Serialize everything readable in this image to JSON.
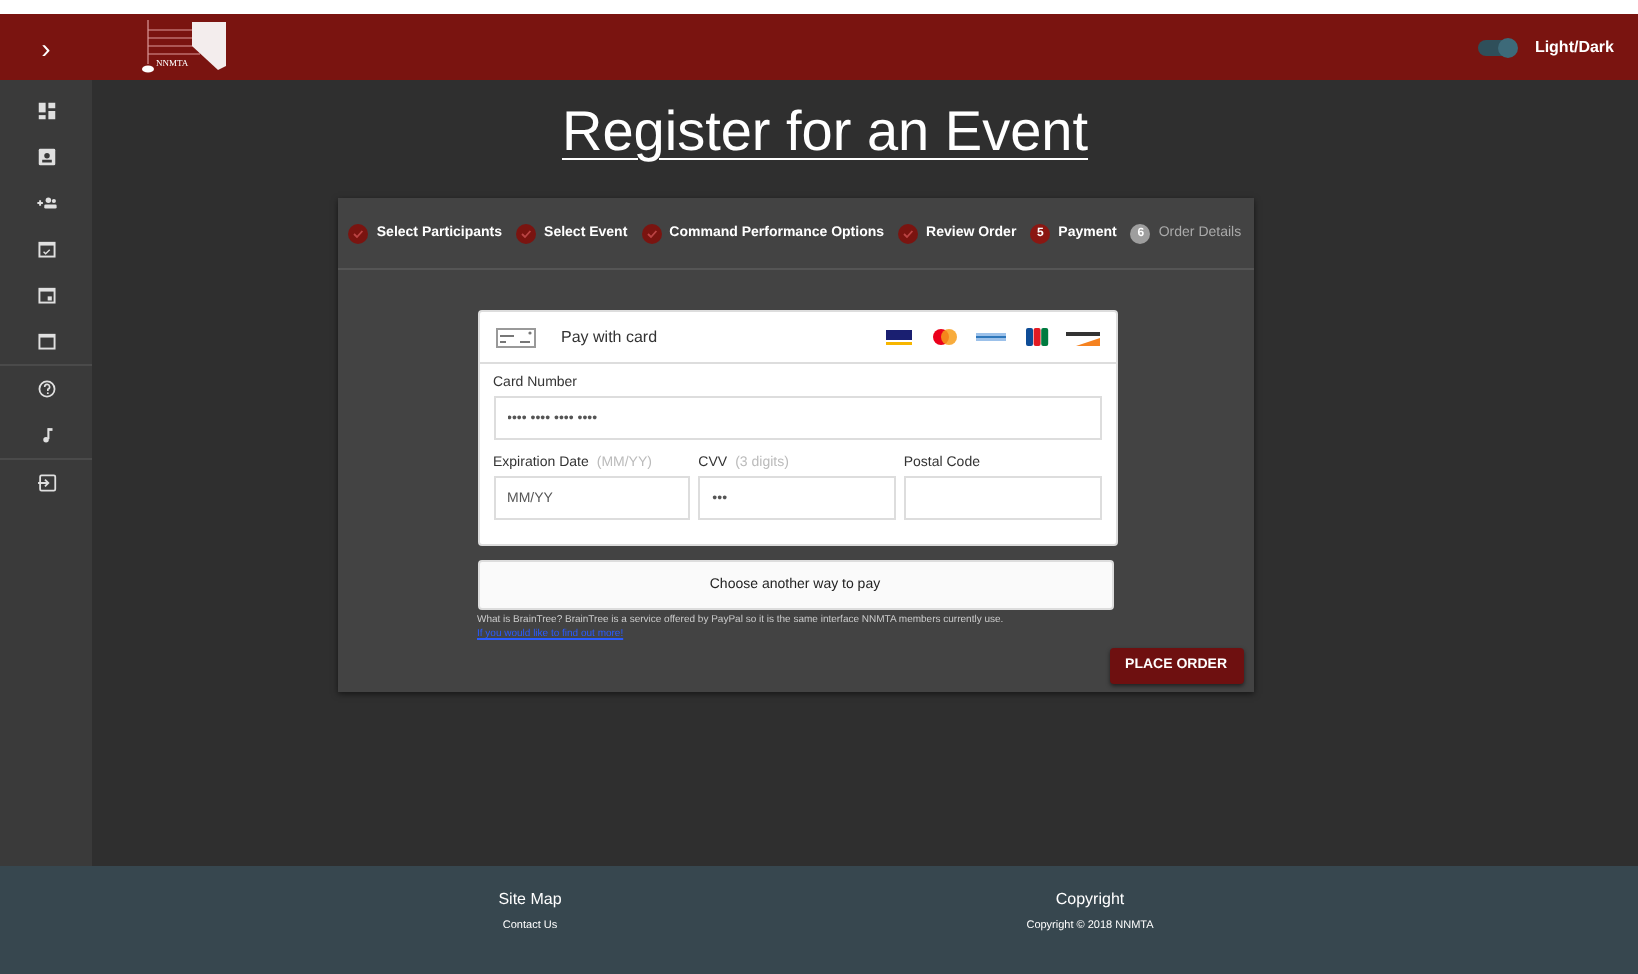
{
  "header": {
    "menu_toggle": "›",
    "logo_text": "NNMTA",
    "theme_toggle": {
      "label": "Light/Dark",
      "on": true
    }
  },
  "title": "Register for an Event",
  "steps": [
    {
      "kind": "done",
      "label": "Select Participants"
    },
    {
      "kind": "done",
      "label": "Select Event"
    },
    {
      "kind": "done",
      "label": "Command Performance Options"
    },
    {
      "kind": "done",
      "label": "Review Order"
    },
    {
      "kind": "current",
      "number": "5",
      "label": "Payment"
    },
    {
      "kind": "pending",
      "number": "6",
      "label": "Order Details"
    }
  ],
  "payment": {
    "heading": "Pay with card",
    "card_number": {
      "label": "Card Number",
      "placeholder": "•••• •••• •••• ••••"
    },
    "expiration": {
      "label": "Expiration Date",
      "hint": "(MM/YY)",
      "placeholder": "MM/YY"
    },
    "cvv": {
      "label": "CVV",
      "hint": "(3 digits)",
      "placeholder": "•••"
    },
    "postal": {
      "label": "Postal Code"
    },
    "other_way": "Choose another way to pay",
    "note": "What is BrainTree? BrainTree is a service offered by PayPal so it is the same interface NNMTA members currently use.",
    "link": "If you would like to find out more!",
    "submit": "PLACE ORDER"
  },
  "footer": [
    {
      "heading": "Site Map",
      "link": "Contact Us"
    },
    {
      "heading": "Copyright",
      "link": "Copyright © 2018 NNMTA"
    }
  ]
}
